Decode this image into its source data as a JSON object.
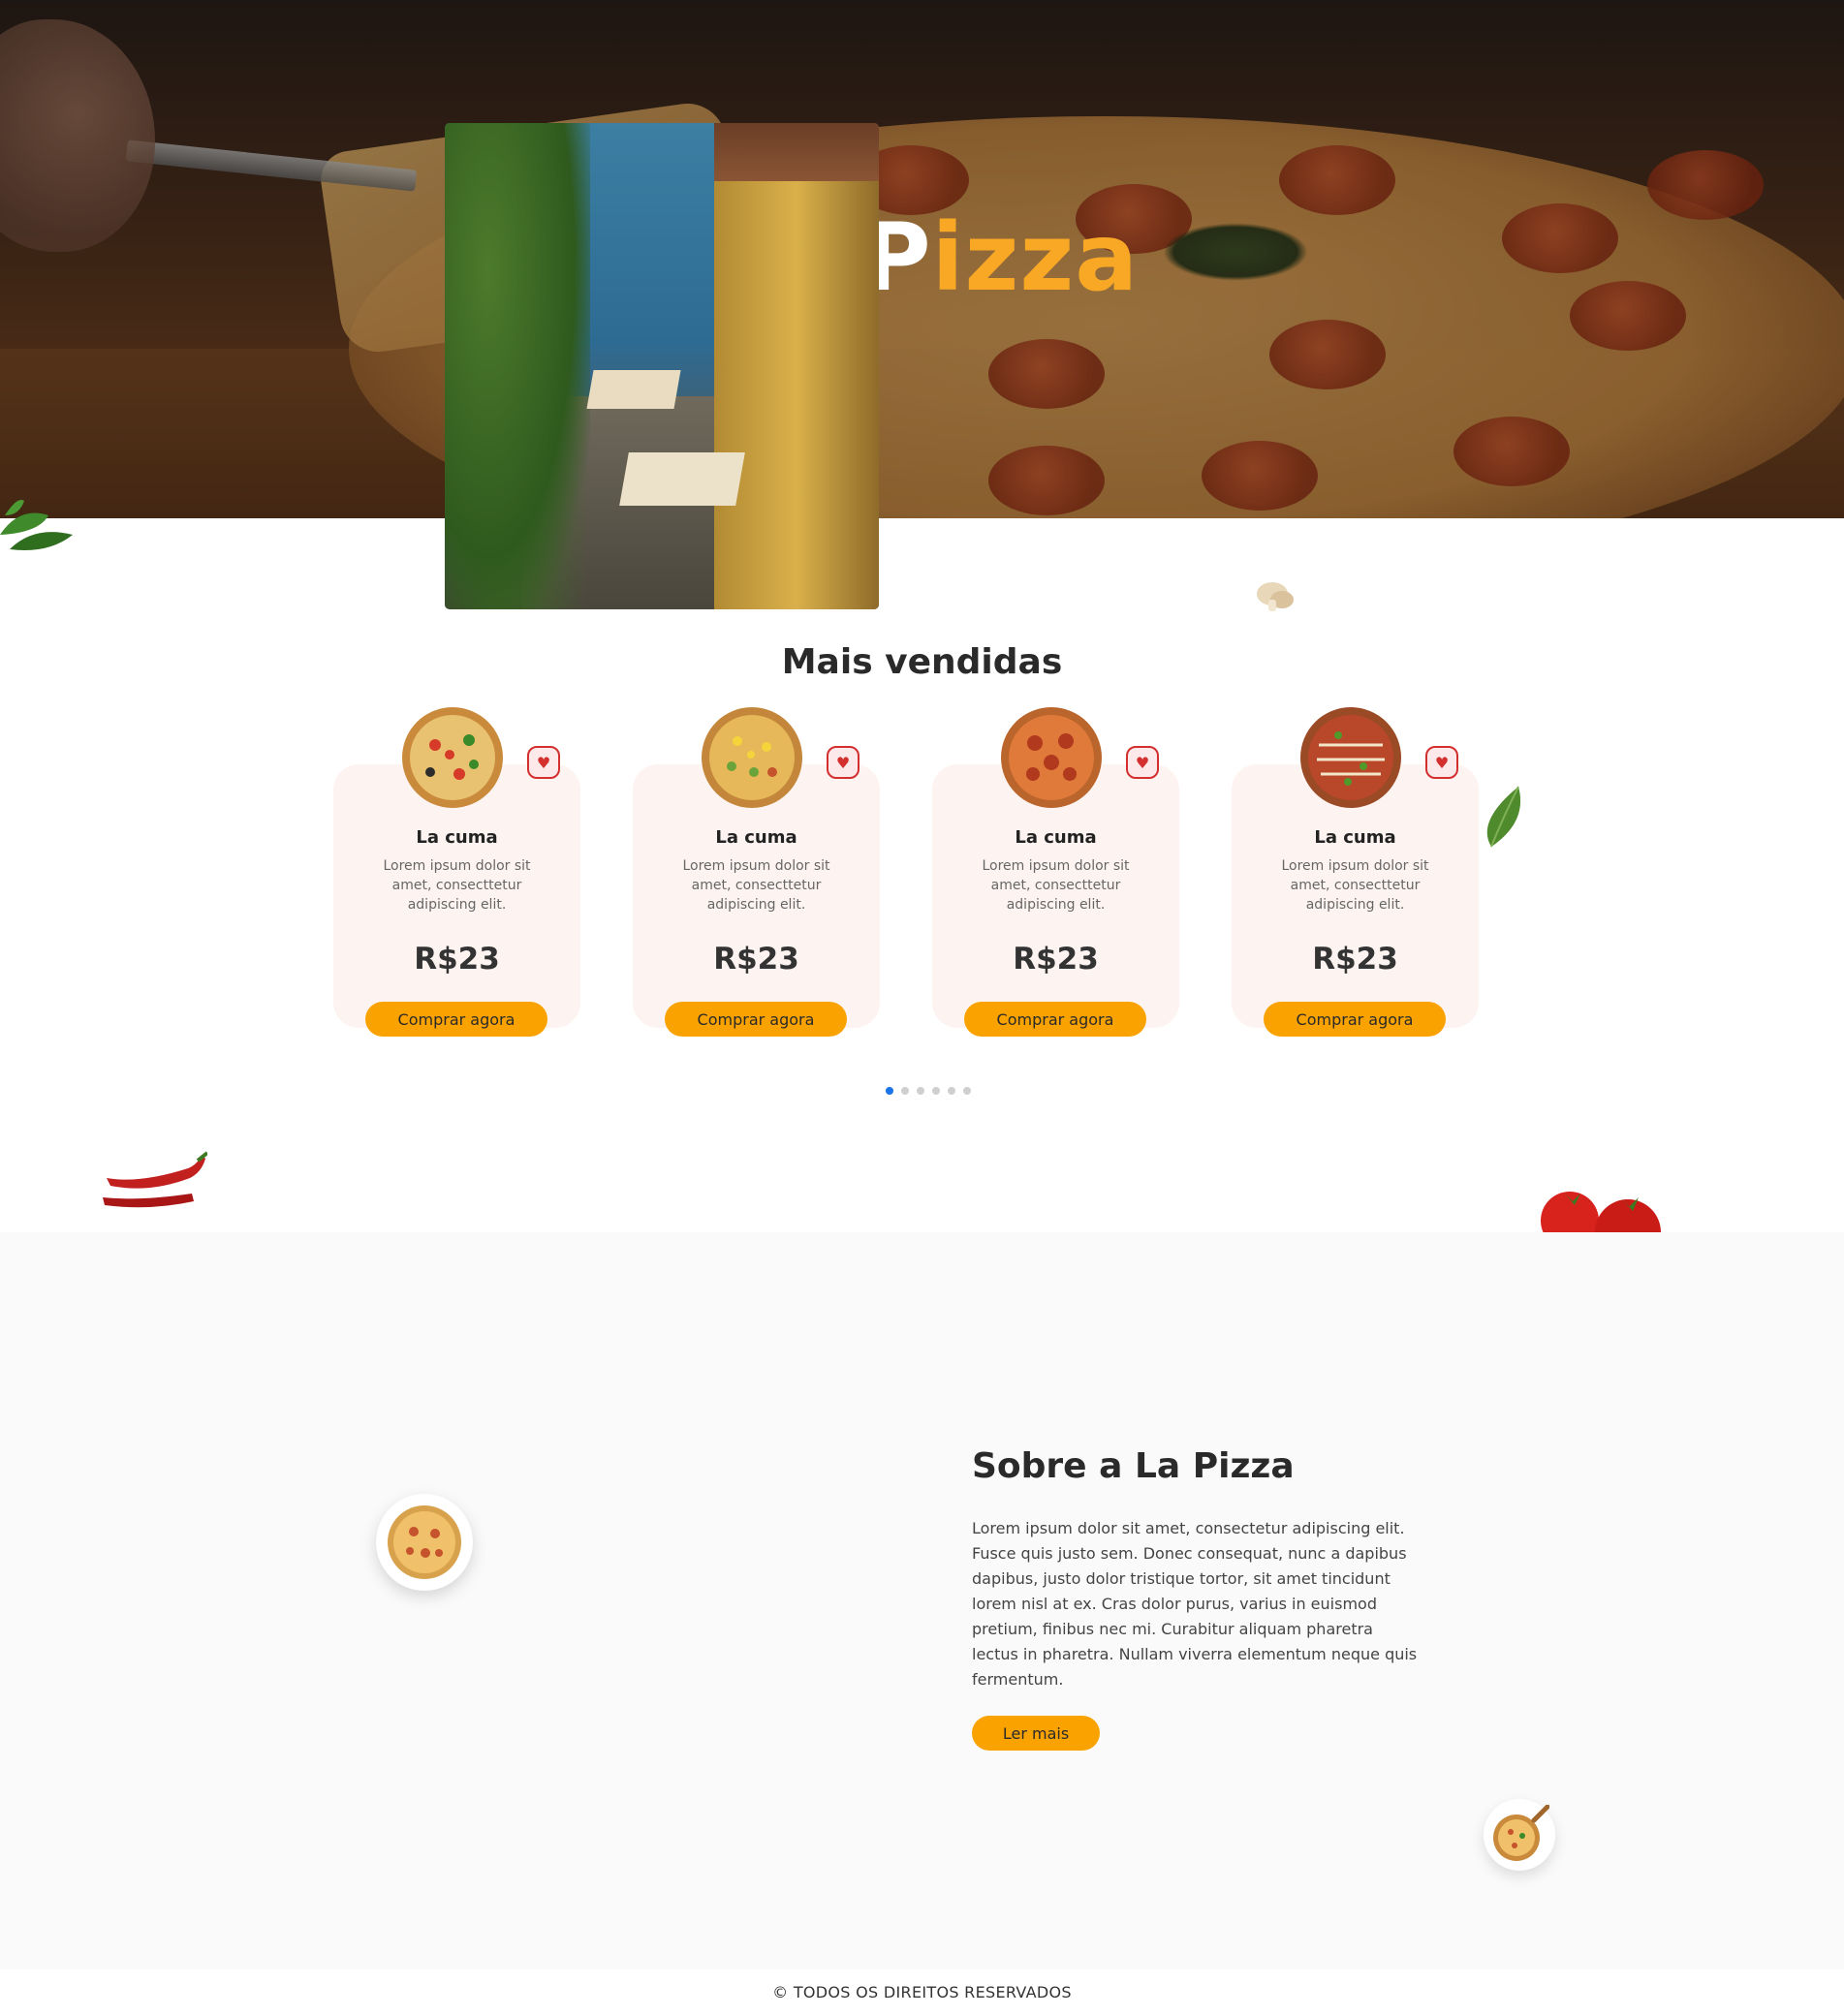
{
  "hero": {
    "title_part1": "La P",
    "title_accent": "izza",
    "title_accent_color": "#f9a826"
  },
  "best_sellers": {
    "title": "Mais vendidas",
    "cards": [
      {
        "name": "La cuma",
        "description": "Lorem ipsum dolor sit amet, consecttetur adipiscing elit.",
        "price": "R$23",
        "button": "Comprar agora",
        "image": "pizza-vegetable-icon",
        "fav_icon": "heart-icon"
      },
      {
        "name": "La cuma",
        "description": "Lorem ipsum dolor sit amet, consecttetur adipiscing elit.",
        "price": "R$23",
        "button": "Comprar agora",
        "image": "pizza-corn-icon",
        "fav_icon": "heart-icon"
      },
      {
        "name": "La cuma",
        "description": "Lorem ipsum dolor sit amet, consecttetur adipiscing elit.",
        "price": "R$23",
        "button": "Comprar agora",
        "image": "pizza-pepperoni-icon",
        "fav_icon": "heart-icon"
      },
      {
        "name": "La cuma",
        "description": "Lorem ipsum dolor sit amet, consecttetur adipiscing elit.",
        "price": "R$23",
        "button": "Comprar agora",
        "image": "pizza-bbq-icon",
        "fav_icon": "heart-icon"
      }
    ],
    "pagination": {
      "total": 6,
      "active": 1
    }
  },
  "about": {
    "title": "Sobre a La Pizza",
    "text": "Lorem ipsum dolor sit amet, consectetur adipiscing elit. Fusce quis justo sem. Donec consequat, nunc a dapibus dapibus, justo dolor tristique tortor, sit amet tincidunt lorem nisl at ex. Cras dolor purus, varius in euismod pretium, finibus nec mi. Curabitur aliquam pharetra lectus in pharetra. Nullam viverra elementum neque quis fermentum.",
    "button": "Ler mais"
  },
  "footer": {
    "text": "© TODOS OS DIREITOS RESERVADOS"
  },
  "colors": {
    "accent": "#f9a200",
    "card_bg": "#fdf4f1",
    "fav_red": "#d32f2f",
    "dot_active": "#1a73e8",
    "section_bg": "#fafafa"
  }
}
